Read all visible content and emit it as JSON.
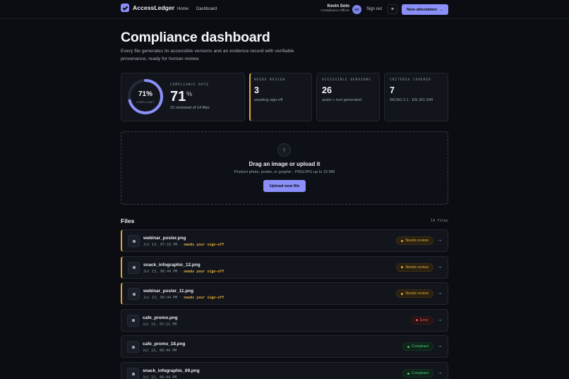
{
  "nav": {
    "brand": "AccessLedger",
    "links": [
      "Home",
      "Dashboard"
    ],
    "user_name": "Kevin Soto",
    "user_role": "Compliance Officer",
    "user_initials": "KS",
    "sign_out": "Sign out",
    "theme_icon": "☀",
    "new_button": "New attestation",
    "new_button_icon": "→"
  },
  "hero": {
    "title": "Compliance dashboard",
    "subtitle": "Every file generates its accessible versions and an evidence record with verifiable provenance, ready for human review."
  },
  "stats": {
    "ring_percent": "71%",
    "ring_fraction": 0.71,
    "ring_label": "COMPLIANT",
    "rate_label": "COMPLIANCE RATE",
    "rate_value": "71",
    "rate_unit": "%",
    "rate_note": "10 reviewed of 14 files",
    "review_label": "NEEDS REVIEW",
    "review_value": "3",
    "review_note": "awaiting sign-off",
    "access_label": "ACCESSIBLE VERSIONS",
    "access_value": "26",
    "access_note": "audio + text generated",
    "crit_label": "CRITERIA COVERED",
    "crit_value": "7",
    "crit_note": "WCAG 2.1 · EN 301 549"
  },
  "upload": {
    "icon": "↑",
    "title": "Drag an image or upload it",
    "subtitle": "Product photo, poster, or graphic · PNG/JPG up to 15 MB",
    "button": "Upload new file"
  },
  "files": {
    "title": "Files",
    "count": "14 files",
    "items": [
      {
        "name": "webinar_poster.png",
        "time": "Jul 13, 07:10 PM",
        "flag": "needs your sign-off",
        "status": "Needs review"
      },
      {
        "name": "snack_infographic_12.png",
        "time": "Jul 13, 06:44 PM",
        "flag": "needs your sign-off",
        "status": "Needs review"
      },
      {
        "name": "webinar_poster_11.png",
        "time": "Jul 13, 06:44 PM",
        "flag": "needs your sign-off",
        "status": "Needs review"
      },
      {
        "name": "cafe_promo.png",
        "time": "Jul 13, 07:11 PM",
        "flag": "",
        "status": "Error"
      },
      {
        "name": "cafe_promo_18.png",
        "time": "Jul 13, 06:44 PM",
        "flag": "",
        "status": "Compliant"
      },
      {
        "name": "snack_infographic_69.png",
        "time": "Jul 13, 06:44 PM",
        "flag": "",
        "status": "Compliant"
      }
    ],
    "sep": "·",
    "row_arrow": "→"
  },
  "colors": {
    "accent": "#8b8ff8",
    "warning": "#e0a93a",
    "error": "#ef5a63",
    "success": "#46c27a"
  }
}
